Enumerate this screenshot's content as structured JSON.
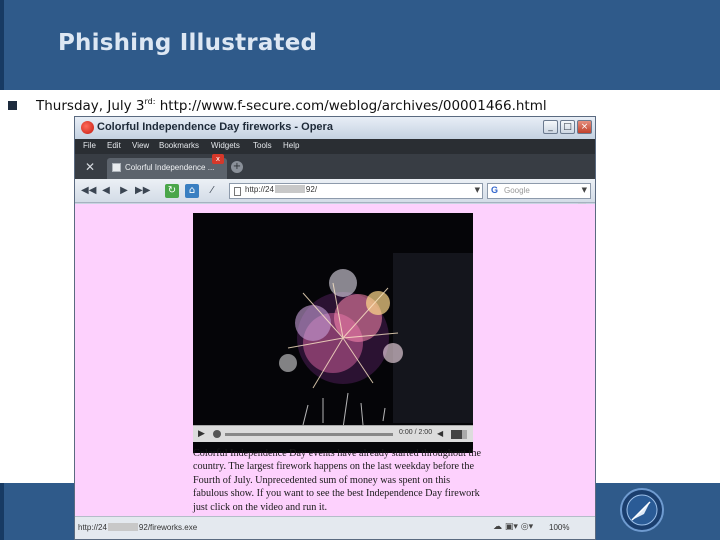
{
  "slide": {
    "title": "Phishing Illustrated",
    "bullet": {
      "prefix": "Thursday, July 3",
      "superscript": "rd:",
      "url": " http://www.f-secure.com/weblog/archives/00001466.html"
    },
    "colors": {
      "band": "#2f5a8a",
      "title": "#dde7f3"
    }
  },
  "browser": {
    "window_title": "Colorful Independence Day fireworks - Opera",
    "menu": [
      "File",
      "Edit",
      "View",
      "Bookmarks",
      "Widgets",
      "Tools",
      "Help"
    ],
    "tab_label": "Colorful Independence ...",
    "tab_close": "x",
    "address_prefix": "http://24",
    "address_suffix": "92/",
    "search_brand": "G",
    "search_placeholder": "Google",
    "video_time": "0:00 / 2:00",
    "description": "Colorful Independence Day events have already started throughout the country. The largest firework happens on the last weekday before the Fourth of July. Unprecedented sum of money was spent on this fabulous show. If you want to see the best Independence Day firework just click on the video and run it.",
    "status_prefix": "http://24",
    "status_suffix": "92/fireworks.exe",
    "zoom": "100%",
    "page_background": "#fdd1fd"
  }
}
